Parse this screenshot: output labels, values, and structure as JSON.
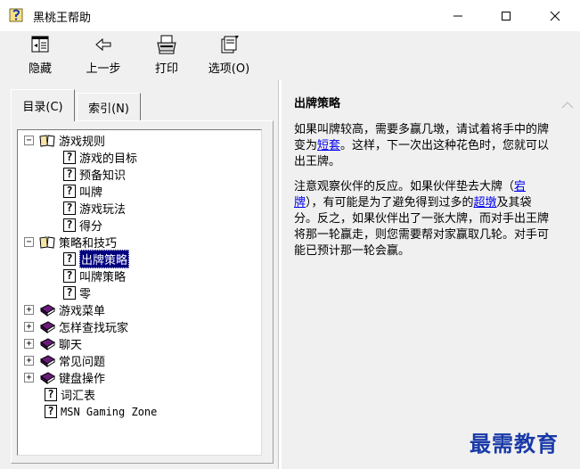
{
  "window": {
    "title": "黑桃王帮助",
    "controls": [
      "minimize",
      "maximize",
      "close"
    ]
  },
  "toolbar": {
    "hide_label": "隐藏",
    "back_label": "上一步",
    "print_label": "打印",
    "options_label": "选项(O)"
  },
  "tabs": [
    {
      "label": "目录(C)",
      "active": true
    },
    {
      "label": "索引(N)",
      "active": false
    }
  ],
  "tree": {
    "games_rules": "游戏规则",
    "goal": "游戏的目标",
    "prereq": "预备知识",
    "bidding": "叫牌",
    "gameplay": "游戏玩法",
    "scoring": "得分",
    "strategy": "策略和技巧",
    "play_strategy": "出牌策略",
    "bid_strategy": "叫牌策略",
    "zero": "零",
    "game_menu": "游戏菜单",
    "find_players": "怎样查找玩家",
    "chat": "聊天",
    "faq": "常见问题",
    "keyboard": "键盘操作",
    "glossary": "词汇表",
    "msn": "MSN Gaming Zone"
  },
  "topic": {
    "title": "出牌策略",
    "p1_before": "如果叫牌较高，需要多赢几墩，请试着将手中的牌变为",
    "p1_link": "短套",
    "p1_after": "。这样，下一次出这种花色时，您就可以出王牌。",
    "p2_a": "注意观察伙伴的反应。如果伙伴垫去大牌（",
    "p2_link1": "宕牌",
    "p2_b": "），有可能是为了避免得到过多的",
    "p2_link2": "超墩",
    "p2_c": "及其袋分。反之，如果伙伴出了一张大牌，而对手出王牌将那一轮赢走，则您需要帮对家赢取几轮。对手可能已预计那一轮会赢。"
  },
  "watermark": "最需教育"
}
